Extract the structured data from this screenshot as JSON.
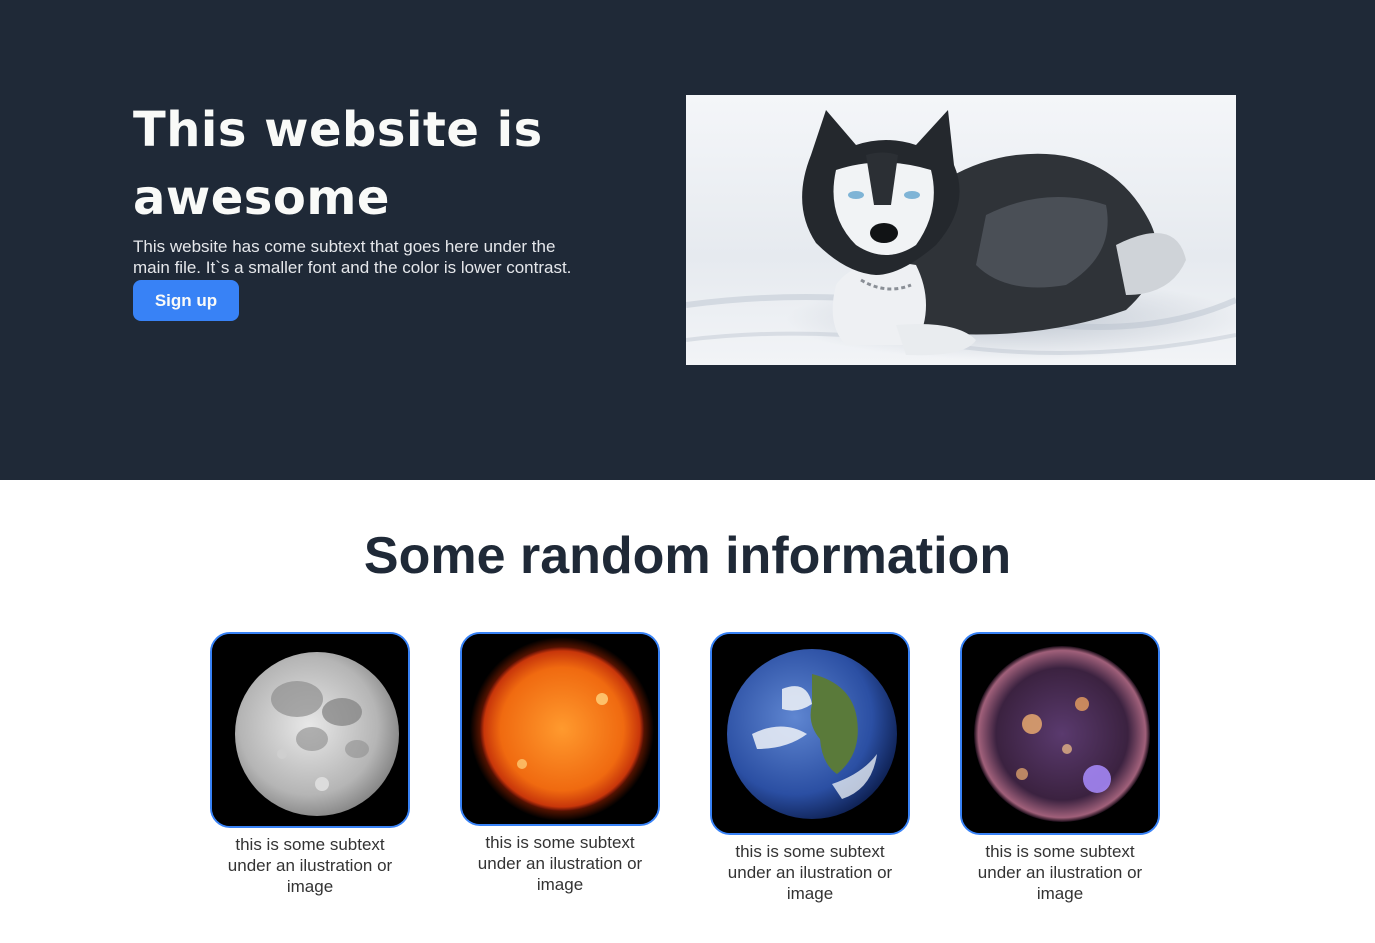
{
  "hero": {
    "title": "This website is awesome",
    "subtitle": "This website has come subtext that goes here under the main file. It`s a smaller font and the color is lower contrast.",
    "signup_label": "Sign up",
    "background_color": "#1f2937",
    "button_color": "#3882f6",
    "image_icon": "husky-in-snow-image"
  },
  "info": {
    "title": "Some random information",
    "cards": [
      {
        "caption": "this is some subtext under an ilustration or image",
        "image_icon": "moon-image"
      },
      {
        "caption": "this is some subtext under an ilustration or image",
        "image_icon": "sun-image"
      },
      {
        "caption": "this is some subtext under an ilustration or image",
        "image_icon": "earth-image"
      },
      {
        "caption": "this is some subtext under an ilustration or image",
        "image_icon": "solar-flare-image"
      }
    ]
  }
}
